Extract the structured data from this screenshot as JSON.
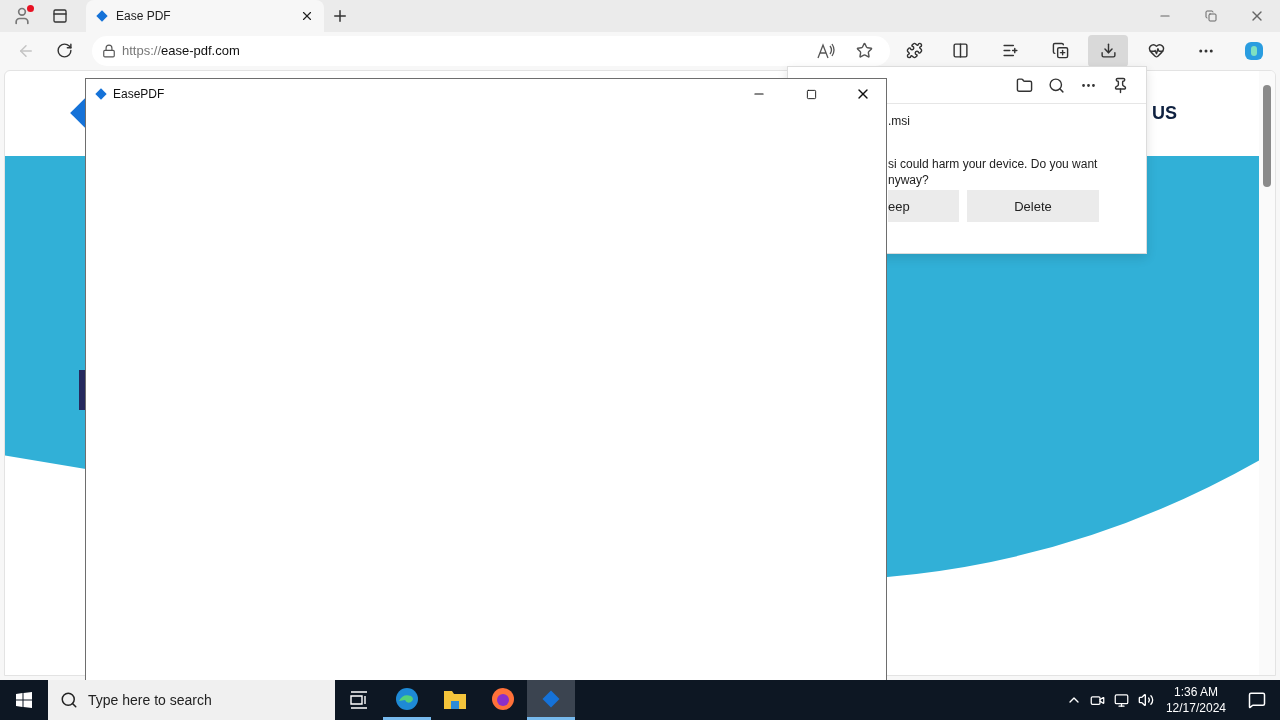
{
  "browser": {
    "tabs": [
      {
        "title": "Ease PDF",
        "selected": true
      }
    ],
    "address": {
      "scheme": "https://",
      "host": "ease-pdf.com"
    },
    "back_disabled": true,
    "downloads_active": true
  },
  "page": {
    "nav_fragment": "US",
    "hero_fragments": [
      {
        "kind": "button"
      }
    ]
  },
  "downloads_panel": {
    "file": ".msi",
    "warning_lines": [
      "si could harm your device. Do you want",
      "nyway?"
    ],
    "buttons": [
      "eep",
      "Delete"
    ]
  },
  "app_window": {
    "title": "EasePDF"
  },
  "taskbar": {
    "search": {
      "placeholder": "Type here to search"
    },
    "apps": [
      {
        "kind": "edge",
        "running": true,
        "selected": false
      },
      {
        "kind": "explorer",
        "running": false,
        "selected": false
      },
      {
        "kind": "firefox",
        "running": false,
        "selected": false
      },
      {
        "kind": "easepdf",
        "running": true,
        "selected": true
      }
    ],
    "time": "1:36 AM",
    "date": "12/17/2024"
  }
}
